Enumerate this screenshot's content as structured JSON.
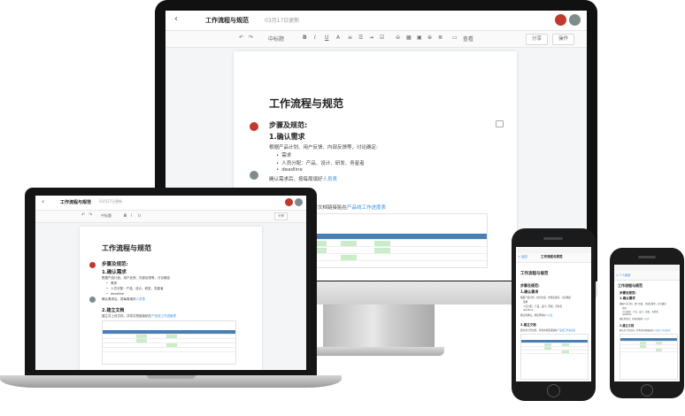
{
  "doc": {
    "title": "工作流程与规范",
    "updated": "03月17日更新",
    "heading": "工作流程与规范",
    "section_steps": "步骤及规范:",
    "step1": "1.确认需求",
    "step1_desc": "根据产品计划、用户反馈、内部反馈等，讨论确定:",
    "bullets": [
      "需求",
      "人员分配：产品、设计、研发、务星者",
      "deadline"
    ],
    "confirm": "确认需求后，按每周填好",
    "confirm_link": "人员表",
    "step2": "2.建立文档",
    "step2_desc": "建立并上传文档，并将文档链接贴在",
    "step2_link": "产品线工作进度表"
  },
  "toolbar": {
    "undo": "↶",
    "redo": "↷",
    "heading_select": "中标题",
    "bold": "B",
    "italic": "I",
    "underline": "U",
    "strike": "A",
    "view": "查看",
    "share": "分享",
    "actions": "操作"
  },
  "phone": {
    "back": "< 返回",
    "back2": "< 个人频道",
    "title": "工作流程与规范"
  },
  "colors": {
    "accent": "#3a8ee6",
    "table_header": "#4a7fb5",
    "table_green": "#c9ecc9"
  }
}
